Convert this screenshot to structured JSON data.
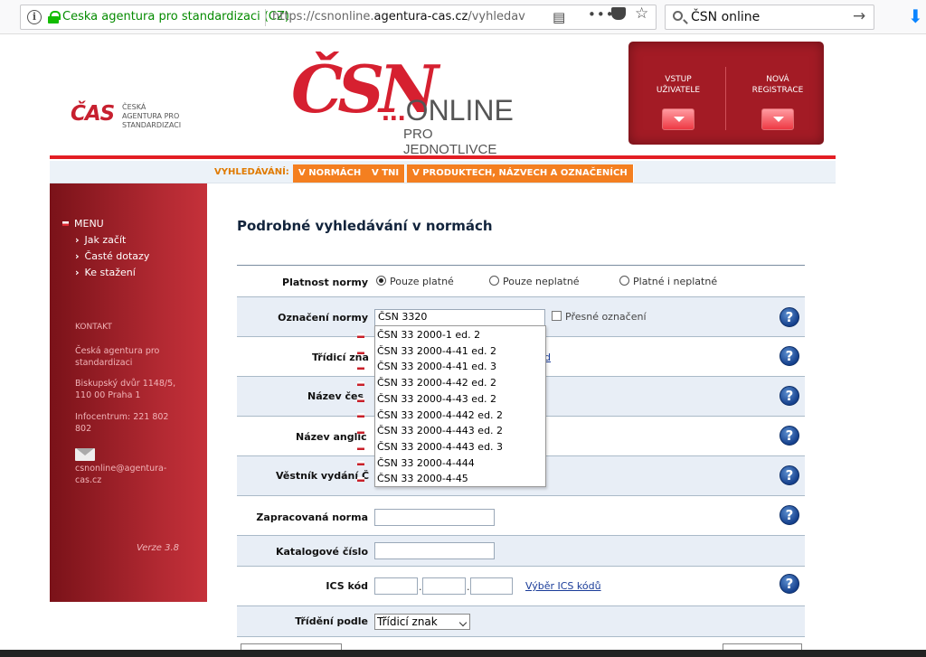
{
  "browser": {
    "site_identity": "Ceska agentura pro standardizaci (CZ)",
    "url_prefix": "https://csnonline.",
    "url_domain": "agentura-cas.cz",
    "url_path": "/vyhledavani.as",
    "search_text": "ČSN online",
    "icons": [
      "info-icon",
      "lock-icon",
      "reader-view-icon",
      "more-icon",
      "pocket-icon",
      "bookmark-star-icon",
      "search-icon",
      "go-arrow-icon",
      "download-icon"
    ]
  },
  "header": {
    "cas_logo_mark": "ČAS",
    "cas_logo_text": [
      "ČESKÁ",
      "AGENTURA PRO",
      "STANDARDIZACI"
    ],
    "csn_logo": "ČSN",
    "csn_dots": "...",
    "csn_online": "ONLINE",
    "csn_sub": "PRO JEDNOTLIVCE",
    "login": [
      "VSTUP",
      "UŽIVATELE"
    ],
    "register": [
      "NOVÁ",
      "REGISTRACE"
    ]
  },
  "nav": {
    "label": "VYHLEDÁVÁNÍ:",
    "tabs": [
      "V NORMÁCH",
      "V TNI",
      "V PRODUKTECH, NÁZVECH A OZNAČENÍCH"
    ]
  },
  "sidebar": {
    "menu": "MENU",
    "items": [
      "Jak začít",
      "Časté dotazy",
      "Ke stažení"
    ],
    "kontakt": "KONTAKT",
    "org": [
      "Česká agentura pro",
      "standardizaci"
    ],
    "address": [
      "Biskupský dvůr 1148/5,",
      "110 00 Praha 1"
    ],
    "phone": [
      "Infocentrum: 221 802",
      "802"
    ],
    "email": [
      "csnonline@agentura-",
      "cas.cz"
    ],
    "version": "Verze 3.8"
  },
  "page": {
    "title": "Podrobné vyhledávání v normách"
  },
  "form": {
    "platnost_label": "Platnost normy",
    "platnost_options": [
      "Pouze platné",
      "Pouze neplatné",
      "Platné i neplatné"
    ],
    "platnost_selected": "Pouze platné",
    "oznaceni_label": "Označení normy",
    "oznaceni_value": "ČSN 3320",
    "presne_label": "Přesné označení",
    "tridici_label": "Třídicí zna",
    "tridici_link_tail": "d",
    "nazev_cesky_label": "Název čes",
    "nazev_anglicky_label": "Název anglic",
    "vestnik_label": "Věstník vydání Č",
    "zapracovana_label": "Zapracovaná norma",
    "katalogove_label": "Katalogové číslo",
    "ics_label": "ICS kód",
    "ics_sep": ".",
    "ics_link": "Výběr ICS kódů",
    "trideni_label": "Třídění podle",
    "trideni_value": "Třídicí znak",
    "help_symbol": "?"
  },
  "autocomplete": [
    "ČSN 33 2000-1 ed. 2",
    "ČSN 33 2000-4-41 ed. 2",
    "ČSN 33 2000-4-41 ed. 3",
    "ČSN 33 2000-4-42 ed. 2",
    "ČSN 33 2000-4-43 ed. 2",
    "ČSN 33 2000-4-442 ed. 2",
    "ČSN 33 2000-4-443 ed. 2",
    "ČSN 33 2000-4-443 ed. 3",
    "ČSN 33 2000-4-444",
    "ČSN 33 2000-4-45"
  ],
  "colors": {
    "brand_red": "#d62030",
    "nav_orange": "#f47f20",
    "sidebar_red": "#b22932",
    "help_blue": "#15408c"
  }
}
